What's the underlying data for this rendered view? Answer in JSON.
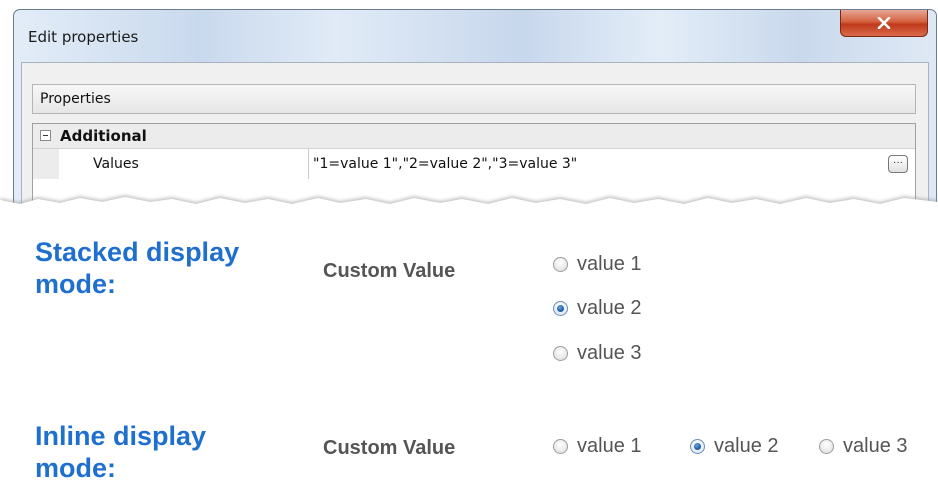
{
  "dialog": {
    "title": "Edit properties",
    "close_icon": "close-x-icon",
    "properties_header": "Properties",
    "category": "Additional",
    "property_name": "Values",
    "property_value": "\"1=value 1\",\"2=value 2\",\"3=value 3\"",
    "ellipsis_label": "···"
  },
  "stacked": {
    "title_line1": "Stacked display",
    "title_line2": "mode:",
    "label": "Custom Value",
    "options": [
      "value 1",
      "value 2",
      "value 3"
    ],
    "selected": "value 2"
  },
  "inline": {
    "title_line1": "Inline display",
    "title_line2": "mode:",
    "label": "Custom Value",
    "options": [
      "value 1",
      "value 2",
      "value 3"
    ],
    "selected": "value 2"
  },
  "colors": {
    "mode_title": "#1f6fce",
    "close_button": "#c0391a",
    "radio_selected": "#1c5fa6"
  }
}
